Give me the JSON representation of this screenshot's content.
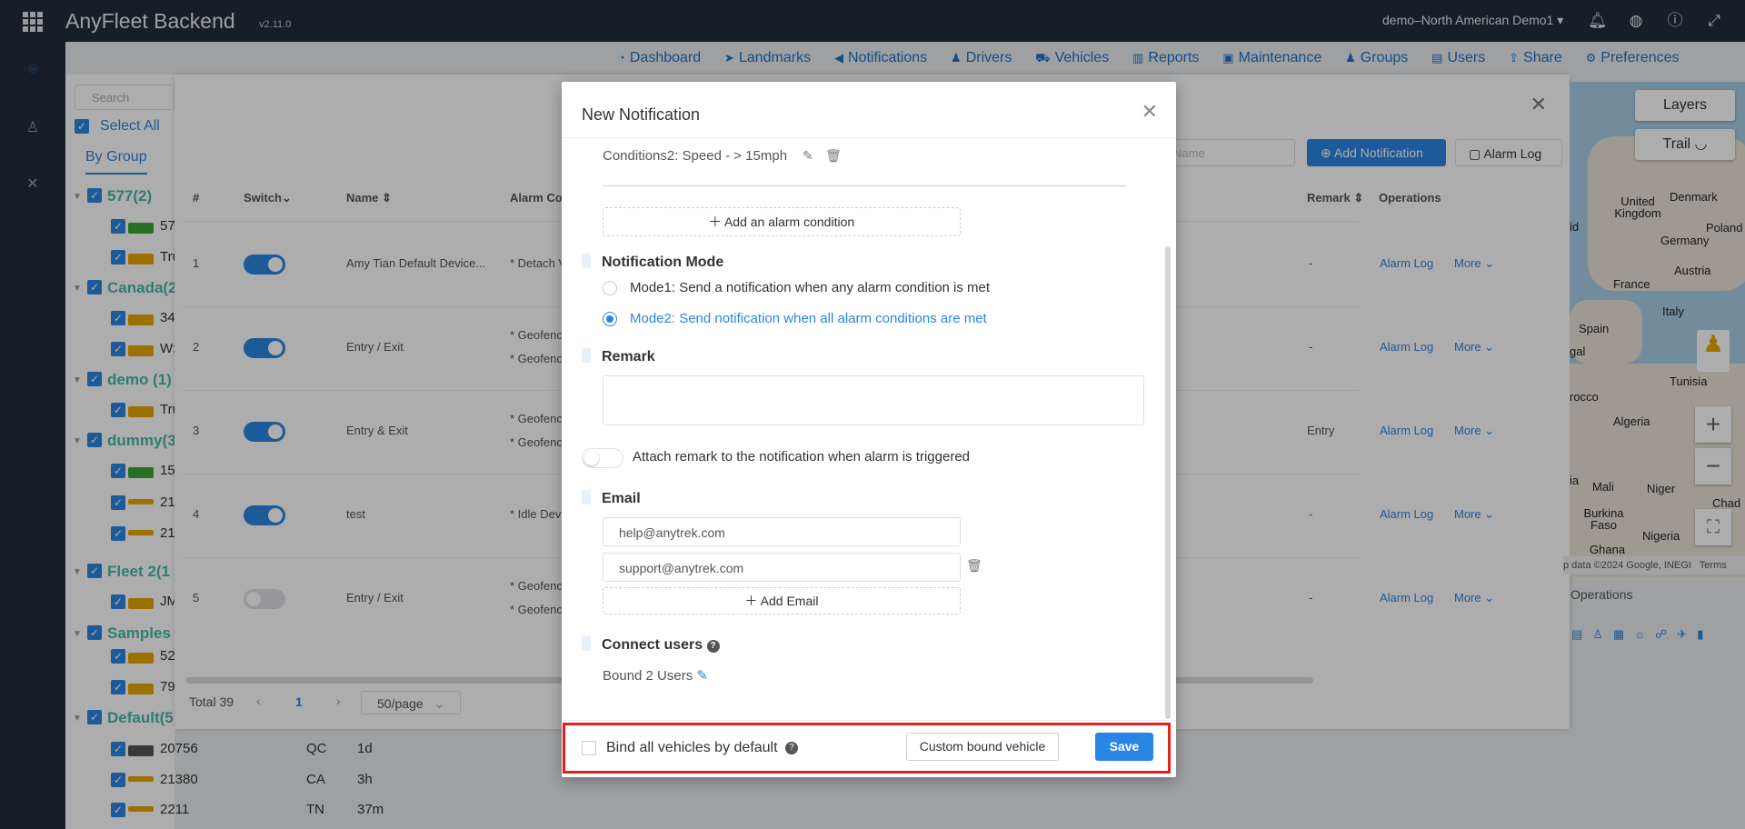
{
  "app": {
    "title": "AnyFleet Backend",
    "version": "v2.11.0",
    "account": "demo–North American Demo1"
  },
  "menu": [
    "Dashboard",
    "Landmarks",
    "Notifications",
    "Drivers",
    "Vehicles",
    "Reports",
    "Maintenance",
    "Groups",
    "Users",
    "Share",
    "Preferences"
  ],
  "sidebar": {
    "search_placeholder": "Search",
    "select_all": "Select All",
    "by_group": "By Group",
    "groups": [
      "577(2)",
      "Canada(2",
      "demo (1)",
      "dummy(3",
      "Fleet 2(1",
      "Samples",
      "Default(5"
    ],
    "vehicles_partial": [
      "57",
      "Tru",
      "34",
      "W:",
      "Tru",
      "15",
      "21",
      "21",
      "JM",
      "52",
      "79"
    ],
    "default_rows": [
      {
        "name": "20756",
        "state": "QC",
        "age": "1d"
      },
      {
        "name": "21380",
        "state": "CA",
        "age": "3h"
      },
      {
        "name": "2211",
        "state": "TN",
        "age": "37m"
      }
    ]
  },
  "table": {
    "headers": {
      "num": "#",
      "switch": "Switch",
      "name": "Name",
      "alarm": "Alarm Co",
      "remark": "Remark",
      "ops": "Operations"
    },
    "name_placeholder": "Name",
    "add_notification": "Add Notification",
    "alarm_log_btn": "Alarm Log",
    "rows": [
      {
        "num": "1",
        "on": true,
        "name": "Amy Tian Default Device...",
        "alarm": [
          "* Detach V"
        ],
        "remark": "-"
      },
      {
        "num": "2",
        "on": true,
        "name": "Entry / Exit",
        "alarm": [
          "* Geofenc",
          "* Geofenc"
        ],
        "remark": "-"
      },
      {
        "num": "3",
        "on": true,
        "name": "Entry & Exit",
        "alarm": [
          "* Geofenc",
          "* Geofenc"
        ],
        "remark": "Entry"
      },
      {
        "num": "4",
        "on": true,
        "name": "test",
        "alarm": [
          "* Idle Dev"
        ],
        "remark": "-"
      },
      {
        "num": "5",
        "on": false,
        "name": "Entry / Exit",
        "alarm": [
          "* Geofenc",
          "* Geofenc"
        ],
        "remark": "-"
      }
    ],
    "op_alarm_log": "Alarm Log",
    "op_more": "More",
    "total": "Total 39",
    "page": "1",
    "per_page": "50/page"
  },
  "map": {
    "layers": "Layers",
    "trail": "Trail",
    "labels": [
      "United Kingdom",
      "Denmark",
      "Poland",
      "Germany",
      "Austria",
      "France",
      "Italy",
      "Spain",
      "gal",
      "Tunisia",
      "rocco",
      "Algeria",
      "ia",
      "Mali",
      "Niger",
      "Chad",
      "Burkina Faso",
      "Nigeria",
      "Ghana",
      "id"
    ],
    "attribution": "p data ©2024 Google, INEGI",
    "terms": "Terms",
    "operations": "Operations"
  },
  "modal": {
    "title": "New Notification",
    "condition": "Conditions2: Speed - > 15mph",
    "add_condition": "Add an alarm condition",
    "mode_title": "Notification Mode",
    "mode1": "Mode1: Send a notification when any alarm condition is met",
    "mode2": "Mode2: Send notification when all alarm conditions are met",
    "selected_mode": 2,
    "remark_title": "Remark",
    "remark_value": "",
    "attach_remark": "Attach remark to the notification when alarm is triggered",
    "attach_remark_on": false,
    "email_title": "Email",
    "emails": [
      "help@anytrek.com",
      "support@anytrek.com"
    ],
    "add_email": "Add Email",
    "connect_users": "Connect users",
    "bound_users": "Bound 2 Users",
    "bind_all": "Bind all vehicles by default",
    "bind_all_checked": false,
    "custom_bound": "Custom bound vehicle",
    "save": "Save"
  },
  "colors": {
    "accent": "#2b85e4",
    "topbar": "#1f2d3d",
    "group": "#47b8a6",
    "highlight": "#e02020"
  }
}
